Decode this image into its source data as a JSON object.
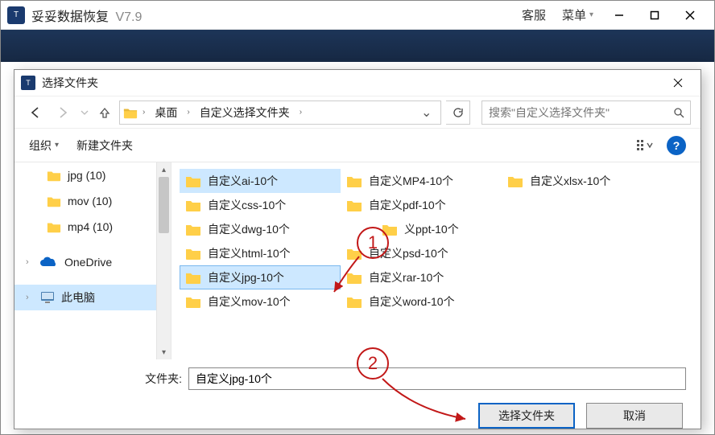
{
  "main": {
    "title": "妥妥数据恢复",
    "version": "V7.9",
    "menu_service": "客服",
    "menu_main": "菜单"
  },
  "dialog": {
    "title": "选择文件夹",
    "breadcrumbs": {
      "b1": "桌面",
      "b2": "自定义选择文件夹"
    },
    "search_placeholder": "搜索\"自定义选择文件夹\"",
    "organize": "组织",
    "new_folder": "新建文件夹"
  },
  "sidebar": {
    "items": [
      {
        "label": "jpg (10)"
      },
      {
        "label": "mov (10)"
      },
      {
        "label": "mp4 (10)"
      },
      {
        "label": "OneDrive"
      },
      {
        "label": "此电脑"
      }
    ]
  },
  "files": {
    "col1": [
      "自定义ai-10个",
      "自定义css-10个",
      "自定义dwg-10个",
      "自定义html-10个",
      "自定义jpg-10个",
      "自定义mov-10个"
    ],
    "col2": [
      "自定义MP4-10个",
      "自定义pdf-10个",
      "义ppt-10个",
      "自定义psd-10个",
      "自定义rar-10个",
      "自定义word-10个"
    ],
    "col3": [
      "自定义xlsx-10个"
    ]
  },
  "footer": {
    "label": "文件夹:",
    "input_value": "自定义jpg-10个",
    "ok": "选择文件夹",
    "cancel": "取消"
  },
  "callouts": {
    "n1": "1",
    "n2": "2"
  }
}
